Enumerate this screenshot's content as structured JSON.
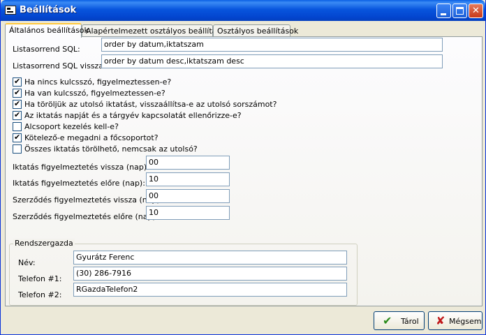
{
  "window": {
    "title": "Beállítások"
  },
  "tabs": [
    {
      "label": "Általános beállítások"
    },
    {
      "label": "Alapértelmezett osztályos beállítások"
    },
    {
      "label": "Osztályos beállítások"
    }
  ],
  "sql": {
    "order_label": "Listasorrend SQL:",
    "order_value": "order by datum,iktatszam",
    "order_back_label": "Listasorrend SQL vissza:",
    "order_back_value": "order by datum desc,iktatszam desc"
  },
  "checkboxes": [
    {
      "label": "Ha nincs kulcsszó, figyelmeztessen-e?",
      "checked": true
    },
    {
      "label": "Ha van kulcsszó, figyelmeztessen-e?",
      "checked": true
    },
    {
      "label": "Ha töröljük az utolsó iktatást, visszaállítsa-e az utolsó sorszámot?",
      "checked": true
    },
    {
      "label": "Az iktatás napját és a tárgyév kapcsolatát ellenőrizze-e?",
      "checked": true
    },
    {
      "label": "Alcsoport kezelés kell-e?",
      "checked": false
    },
    {
      "label": "Kötelező-e megadni a főcsoportot?",
      "checked": true
    },
    {
      "label": "Összes iktatás törölhető, nemcsak az utolsó?",
      "checked": false
    }
  ],
  "warnings": [
    {
      "label": "Iktatás figyelmeztetés vissza (nap):",
      "value": "00"
    },
    {
      "label": "Iktatás figyelmeztetés előre (nap):",
      "value": "10"
    },
    {
      "label": "Szerződés figyelmeztetés vissza (nap):",
      "value": "00"
    },
    {
      "label": "Szerződés figyelmeztetés előre (nap):",
      "value": "10"
    }
  ],
  "admin": {
    "group_title": "Rendszergazda",
    "name_label": "Név:",
    "name_value": "Gyurátz Ferenc",
    "phone1_label": "Telefon #1:",
    "phone1_value": "(30) 286-7916",
    "phone2_label": "Telefon #2:",
    "phone2_value": "RGazdaTelefon2"
  },
  "buttons": {
    "save": "Tárol",
    "cancel": "Mégsem"
  },
  "icons": {
    "save": "checkmark-icon",
    "cancel": "x-cross-icon"
  },
  "colors": {
    "titlebar": "#0855dd",
    "save_icon": "#2a8a1a",
    "cancel_icon": "#c0181a"
  }
}
